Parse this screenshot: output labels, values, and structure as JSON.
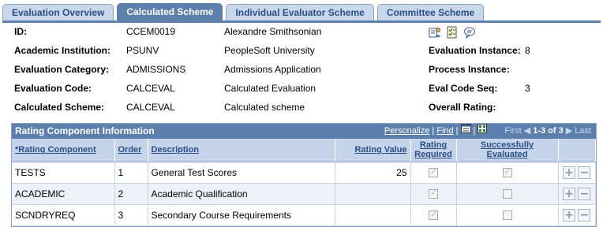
{
  "tabs": [
    {
      "label": "Evaluation Overview",
      "active": false
    },
    {
      "label": "Calculated Scheme",
      "active": true
    },
    {
      "label": "Individual Evaluator Scheme",
      "active": false
    },
    {
      "label": "Committee Scheme",
      "active": false
    }
  ],
  "header": {
    "id_label": "ID:",
    "id_value": "CCEM0019",
    "id_name": "Alexandre Smithsonian",
    "institution_label": "Academic Institution:",
    "institution_value": "PSUNV",
    "institution_desc": "PeopleSoft University",
    "category_label": "Evaluation Category:",
    "category_value": "ADMISSIONS",
    "category_desc": "Admissions Application",
    "code_label": "Evaluation Code:",
    "code_value": "CALCEVAL",
    "code_desc": "Calculated Evaluation",
    "scheme_label": "Calculated Scheme:",
    "scheme_value": "CALCEVAL",
    "scheme_desc": "Calculated scheme",
    "instance_label": "Evaluation Instance:",
    "instance_value": "8",
    "process_label": "Process Instance:",
    "process_value": "",
    "seq_label": "Eval Code Seq:",
    "seq_value": "3",
    "rating_label": "Overall Rating:",
    "rating_value": ""
  },
  "grid": {
    "title": "Rating Component Information",
    "personalize": "Personalize",
    "find": "Find",
    "first": "First",
    "range": "1-3 of 3",
    "last": "Last",
    "columns": {
      "component": "*Rating Component",
      "order": "Order",
      "description": "Description",
      "rating_value": "Rating Value",
      "rating_required": "Rating Required",
      "successfully_evaluated": "Successfully Evaluated"
    },
    "rows": [
      {
        "component": "TESTS",
        "order": "1",
        "description": "General Test Scores",
        "rating_value": "25",
        "required": true,
        "evaluated": true
      },
      {
        "component": "ACADEMIC",
        "order": "2",
        "description": "Academic Qualification",
        "rating_value": "",
        "required": true,
        "evaluated": false
      },
      {
        "component": "SCNDRYREQ",
        "order": "3",
        "description": "Secondary Course Requirements",
        "rating_value": "",
        "required": true,
        "evaluated": false
      }
    ]
  },
  "icons": [
    "evaluation-notes-icon",
    "checklist-icon",
    "comments-icon"
  ],
  "colors": {
    "header_blue": "#5d7fae",
    "tab_light": "#c9d7ea",
    "link_blue": "#2a4f86"
  }
}
